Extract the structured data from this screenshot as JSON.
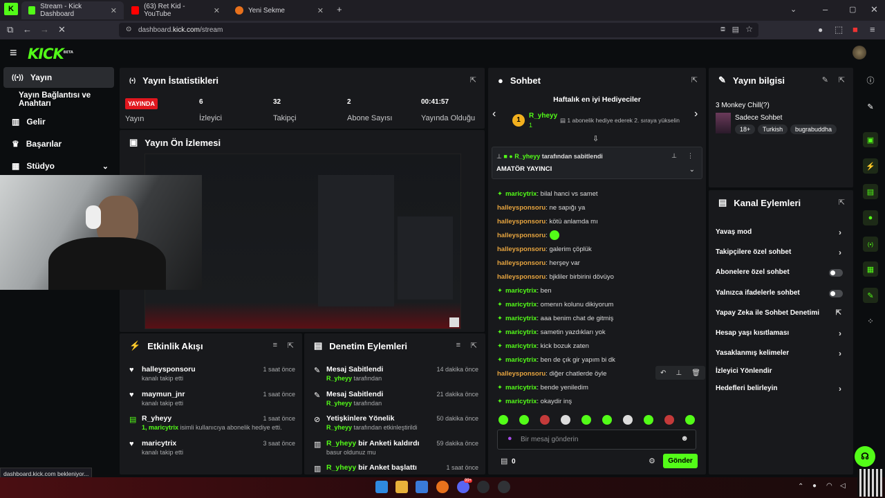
{
  "browser": {
    "tabs": [
      {
        "label": "Stream - Kick Dashboard",
        "active": true
      },
      {
        "label": "(63) Ret Kid - YouTube",
        "active": false
      },
      {
        "label": "Yeni Sekme",
        "active": false
      }
    ],
    "url_prefix": "dashboard.",
    "url_domain": "kick.com",
    "url_path": "/stream",
    "status": "dashboard.kick.com bekleniyor..."
  },
  "app": {
    "logo": "KICK",
    "logo_sup": "BETA",
    "sidebar": [
      {
        "label": "Yayın"
      },
      {
        "label": "Yayın Bağlantısı ve Anahtarı"
      },
      {
        "label": "Gelir"
      },
      {
        "label": "Başarılar"
      },
      {
        "label": "Stüdyo"
      }
    ]
  },
  "stats": {
    "title": "Yayın İstatistikleri",
    "live_badge": "YAYINDA",
    "live_label": "Yayın",
    "items": [
      {
        "value": "6",
        "label": "İzleyici"
      },
      {
        "value": "32",
        "label": "Takipçi"
      },
      {
        "value": "2",
        "label": "Abone Sayısı"
      },
      {
        "value": "00:41:57",
        "label": "Yayında Olduğu"
      }
    ]
  },
  "preview": {
    "title": "Yayın Ön İzlemesi"
  },
  "activity": {
    "title": "Etkinlik Akışı",
    "items": [
      {
        "user": "halleysponsoru",
        "desc": "kanalı takip etti",
        "time": "1 saat önce"
      },
      {
        "user": "maymun_jnr",
        "desc": "kanalı takip etti",
        "time": "1 saat önce"
      },
      {
        "user": "R_yheyy",
        "highlight": "1, maricytrix",
        "desc": "isimli kullanıcıya abonelik hediye etti.",
        "time": "1 saat önce"
      },
      {
        "user": "maricytrix",
        "desc": "kanalı takip etti",
        "time": "3 saat önce"
      }
    ]
  },
  "moderation": {
    "title": "Denetim Eylemleri",
    "items": [
      {
        "title": "Mesaj Sabitlendi",
        "user": "R_yheyy",
        "desc": "tarafından",
        "time": "14 dakika önce"
      },
      {
        "title": "Mesaj Sabitlendi",
        "user": "R_yheyy",
        "desc": "tarafından",
        "time": "21 dakika önce"
      },
      {
        "title": "Yetişkinlere Yönelik",
        "user": "R_yheyy",
        "desc": "tarafından etkinleştirildi",
        "time": "50 dakika önce"
      },
      {
        "title_user": "R_yheyy",
        "title": "bir Anketi kaldırdı",
        "desc": "basur oldunuz mu",
        "time": "59 dakika önce"
      },
      {
        "title_user": "R_yheyy",
        "title": "bir Anket başlattı",
        "desc": "",
        "time": "1 saat önce"
      }
    ]
  },
  "chat": {
    "title": "Sohbet",
    "gifters_title": "Haftalık en iyi Hediyeciler",
    "top_gifter": "R_yheyy",
    "top_gifter_count": "1",
    "gift_hint": "1 abonelik hediye ederek 2. sıraya yükselin",
    "pinned_by_user": "R_yheyy",
    "pinned_by_text": "tarafından sabitlendi",
    "pinned_text": "AMATÖR YAYINCI",
    "messages": [
      {
        "user": "maricytrix",
        "text": "bilal hanci vs samet",
        "gem": true
      },
      {
        "user": "halleysponsoru",
        "text": "ne sapığı ya",
        "gem": false
      },
      {
        "user": "halleysponsoru",
        "text": "kötü anlamda mı",
        "gem": false
      },
      {
        "user": "halleysponsoru",
        "text": "",
        "gem": false,
        "emote": true
      },
      {
        "user": "halleysponsoru",
        "text": "galerim çöplük",
        "gem": false
      },
      {
        "user": "halleysponsoru",
        "text": "herşey var",
        "gem": false
      },
      {
        "user": "halleysponsoru",
        "text": "bjkliler birbirini dövüyo",
        "gem": false
      },
      {
        "user": "maricytrix",
        "text": "ben",
        "gem": true
      },
      {
        "user": "maricytrix",
        "text": "omenın kolunu dikiyorum",
        "gem": true
      },
      {
        "user": "maricytrix",
        "text": "aaa benim chat de gitmiş",
        "gem": true
      },
      {
        "user": "maricytrix",
        "text": "sametin yazdıkları yok",
        "gem": true
      },
      {
        "user": "maricytrix",
        "text": "kick bozuk zaten",
        "gem": true
      },
      {
        "user": "maricytrix",
        "text": "ben de çık gir yapım bi dk",
        "gem": true
      },
      {
        "user": "halleysponsoru",
        "text": "diğer chatlerde öyle",
        "gem": false
      },
      {
        "user": "maricytrix",
        "text": "bende yeniledim",
        "gem": true
      },
      {
        "user": "maricytrix",
        "text": "okaydir inş",
        "gem": true
      }
    ],
    "input_placeholder": "Bir mesaj gönderin",
    "points": "0",
    "send_label": "Gönder"
  },
  "info": {
    "title": "Yayın bilgisi",
    "stream_title": "3 Monkey Chill(?)",
    "category": "Sadece Sohbet",
    "tags": [
      "18+",
      "Turkish",
      "bugrabuddha"
    ]
  },
  "channel_actions": {
    "title": "Kanal Eylemleri",
    "items": [
      {
        "label": "Yavaş mod",
        "kind": "arrow"
      },
      {
        "label": "Takipçilere özel sohbet",
        "kind": "arrow"
      },
      {
        "label": "Abonelere özel sohbet",
        "kind": "toggle"
      },
      {
        "label": "Yalnızca ifadelerle sohbet",
        "kind": "toggle"
      },
      {
        "label": "Yapay Zeka ile Sohbet Denetimi",
        "kind": "ext"
      },
      {
        "label": "Hesap yaşı kısıtlaması",
        "kind": "arrow"
      },
      {
        "label": "Yasaklanmış kelimeler",
        "kind": "arrow"
      },
      {
        "label": "İzleyici Yönlendir",
        "kind": "none"
      },
      {
        "label": "Hedefleri belirleyin",
        "kind": "arrow"
      }
    ]
  },
  "colors": {
    "accent": "#53fc18",
    "live": "#e1171e",
    "halley": "#e6a43f"
  },
  "taskbar": {
    "badge": "99+"
  }
}
